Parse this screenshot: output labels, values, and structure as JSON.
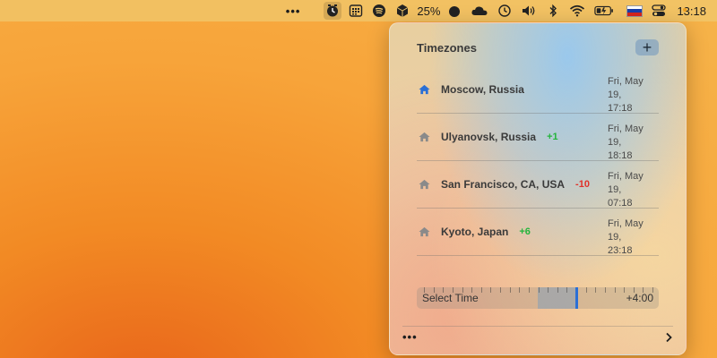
{
  "menubar": {
    "dots": "•••",
    "battery_percent": "25%",
    "clock": "13:18",
    "icons": [
      "timezone-app-icon",
      "calendar-grid-icon",
      "spotify-icon",
      "cube-icon",
      "tomato-icon",
      "cloud-icon",
      "time-machine-icon",
      "volume-icon",
      "bluetooth-icon",
      "wifi-icon",
      "battery-icon",
      "russia-flag-icon",
      "control-center-icon"
    ]
  },
  "panel": {
    "title": "Timezones",
    "add_label": "+",
    "zones": [
      {
        "name": "Moscow, Russia",
        "offset": "",
        "date": "Fri, May 19,",
        "time": "17:18",
        "home": true
      },
      {
        "name": "Ulyanovsk, Russia",
        "offset": "+1",
        "date": "Fri, May 19,",
        "time": "18:18",
        "home": false
      },
      {
        "name": "San Francisco, CA, USA",
        "offset": "-10",
        "date": "Fri, May 19,",
        "time": "07:18",
        "home": false
      },
      {
        "name": "Kyoto, Japan",
        "offset": "+6",
        "date": "Fri, May 19,",
        "time": "23:18",
        "home": false
      }
    ],
    "slider": {
      "label": "Select Time",
      "value": "+4:00"
    },
    "footer_dots": "•••"
  },
  "colors": {
    "positive": "#23b43c",
    "negative": "#e0322a",
    "home_active": "#2a6fd6",
    "home_inactive": "#8a8a8a",
    "slider_thumb": "#2a6fd6"
  }
}
